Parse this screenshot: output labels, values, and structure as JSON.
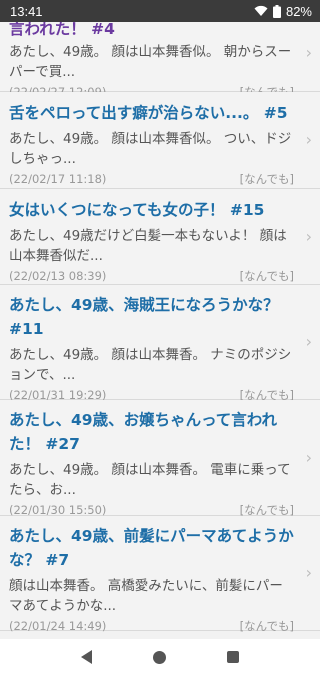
{
  "status": {
    "time": "13:41",
    "battery": "82%"
  },
  "articles": [
    {
      "title": "言われた！ #4",
      "body": "あたし、49歳。 顔は山本舞香似。 朝からスーパーで買...",
      "date": "(22/02/27 12:09)",
      "category": "[なんでも]"
    },
    {
      "title": "舌をペロって出す癖が治らない...。 #5",
      "body": "あたし、49歳。 顔は山本舞香似。 つい、ドジしちゃっ...",
      "date": "(22/02/17 11:18)",
      "category": "[なんでも]"
    },
    {
      "title": "女はいくつになっても女の子！ #15",
      "body": "あたし、49歳だけど白髪一本もないよ！ 顔は山本舞香似だ...",
      "date": "(22/02/13 08:39)",
      "category": "[なんでも]"
    },
    {
      "title": "あたし、49歳、海賊王になろうかな？ #11",
      "body": "あたし、49歳。 顔は山本舞香。 ナミのポジションで、...",
      "date": "(22/01/31 19:29)",
      "category": "[なんでも]"
    },
    {
      "title": "あたし、49歳、お嬢ちゃんって言われた！ #27",
      "body": "あたし、49歳。 顔は山本舞香。 電車に乗ってたら、お...",
      "date": "(22/01/30 15:50)",
      "category": "[なんでも]"
    },
    {
      "title": "あたし、49歳、前髪にパーマあてようかな？ #7",
      "body": "顔は山本舞香。 高橋愛みたいに、前髪にパーマあてようかな...",
      "date": "(22/01/24 14:49)",
      "category": "[なんでも]"
    }
  ],
  "icons": {
    "chevron": "chevron-right-icon",
    "back": "back-icon",
    "home": "home-icon",
    "recent": "recent-apps-icon"
  }
}
